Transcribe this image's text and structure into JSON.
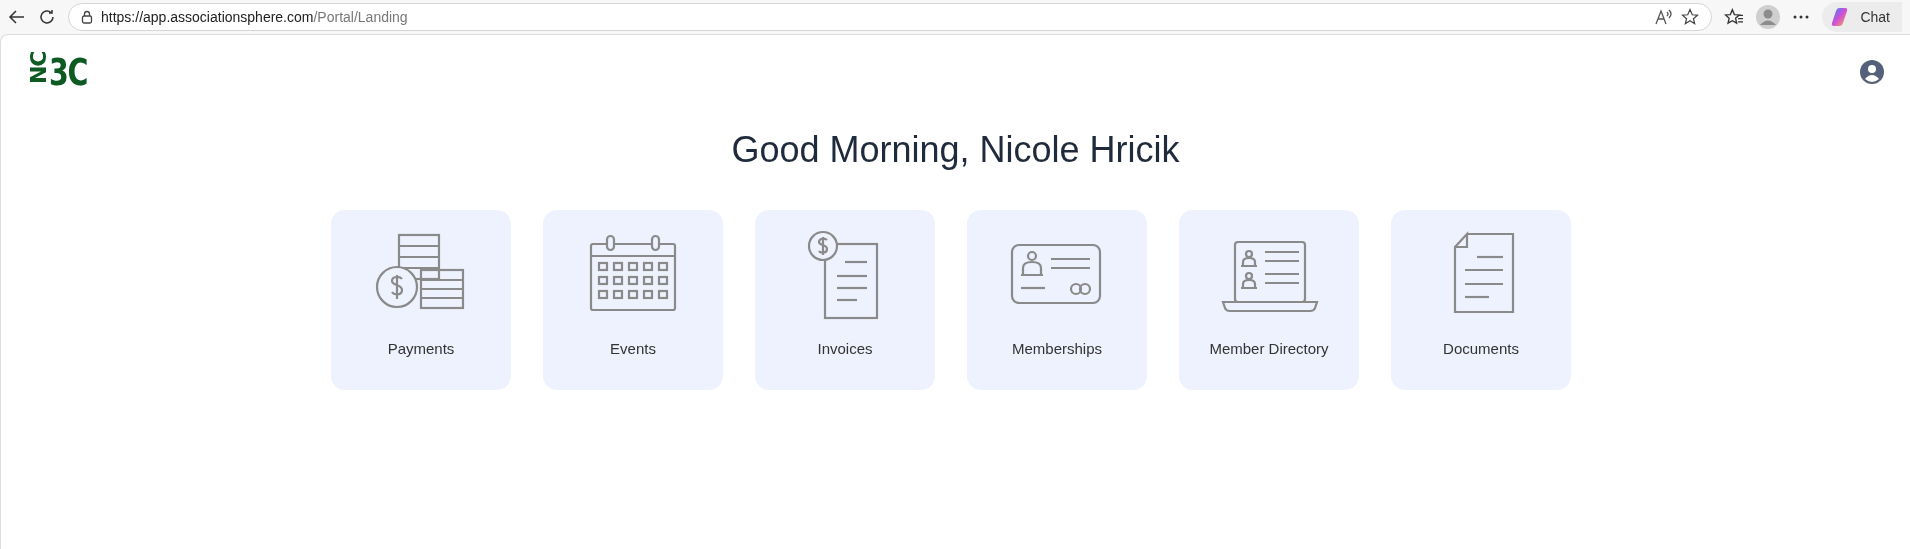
{
  "browser": {
    "url_host": "https://app.associationsphere.com",
    "url_path": "/Portal/Landing",
    "chat_label": "Chat"
  },
  "logo": {
    "rotated": "NC",
    "upright": "3C"
  },
  "greeting": "Good Morning, Nicole Hricik",
  "tiles": [
    {
      "kind": "payments",
      "label": "Payments"
    },
    {
      "kind": "events",
      "label": "Events"
    },
    {
      "kind": "invoices",
      "label": "Invoices"
    },
    {
      "kind": "memberships",
      "label": "Memberships"
    },
    {
      "kind": "directory",
      "label": "Member Directory"
    },
    {
      "kind": "documents",
      "label": "Documents"
    }
  ]
}
